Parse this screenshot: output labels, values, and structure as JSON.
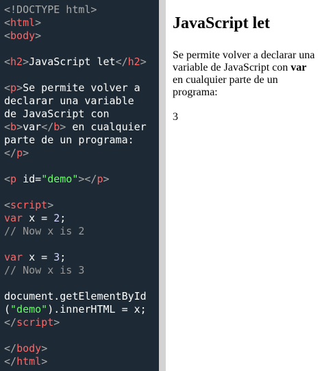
{
  "editor": {
    "code_lines": [
      [
        {
          "t": "<!DOCTYPE html>",
          "c": "bracket"
        }
      ],
      [
        {
          "t": "<",
          "c": "bracket"
        },
        {
          "t": "html",
          "c": "tag"
        },
        {
          "t": ">",
          "c": "bracket"
        }
      ],
      [
        {
          "t": "<",
          "c": "bracket"
        },
        {
          "t": "body",
          "c": "tag"
        },
        {
          "t": ">",
          "c": "bracket"
        }
      ],
      [],
      [
        {
          "t": "<",
          "c": "bracket"
        },
        {
          "t": "h2",
          "c": "tag"
        },
        {
          "t": ">",
          "c": "bracket"
        },
        {
          "t": "JavaScript let",
          "c": "text"
        },
        {
          "t": "</",
          "c": "bracket"
        },
        {
          "t": "h2",
          "c": "tag"
        },
        {
          "t": ">",
          "c": "bracket"
        }
      ],
      [],
      [
        {
          "t": "<",
          "c": "bracket"
        },
        {
          "t": "p",
          "c": "tag"
        },
        {
          "t": ">",
          "c": "bracket"
        },
        {
          "t": "Se permite volver a",
          "c": "text"
        }
      ],
      [
        {
          "t": "declarar una variable",
          "c": "text"
        }
      ],
      [
        {
          "t": "de JavaScript con",
          "c": "text"
        }
      ],
      [
        {
          "t": "<",
          "c": "bracket"
        },
        {
          "t": "b",
          "c": "tag"
        },
        {
          "t": ">",
          "c": "bracket"
        },
        {
          "t": "var",
          "c": "text"
        },
        {
          "t": "</",
          "c": "bracket"
        },
        {
          "t": "b",
          "c": "tag"
        },
        {
          "t": ">",
          "c": "bracket"
        },
        {
          "t": " en cualquier",
          "c": "text"
        }
      ],
      [
        {
          "t": "parte de un programa:",
          "c": "text"
        }
      ],
      [
        {
          "t": "</",
          "c": "bracket"
        },
        {
          "t": "p",
          "c": "tag"
        },
        {
          "t": ">",
          "c": "bracket"
        }
      ],
      [],
      [
        {
          "t": "<",
          "c": "bracket"
        },
        {
          "t": "p",
          "c": "tag"
        },
        {
          "t": " id",
          "c": "attr"
        },
        {
          "t": "=",
          "c": "eq"
        },
        {
          "t": "\"demo\"",
          "c": "string"
        },
        {
          "t": ">",
          "c": "bracket"
        },
        {
          "t": "</",
          "c": "bracket"
        },
        {
          "t": "p",
          "c": "tag"
        },
        {
          "t": ">",
          "c": "bracket"
        }
      ],
      [],
      [
        {
          "t": "<",
          "c": "bracket"
        },
        {
          "t": "script",
          "c": "tag"
        },
        {
          "t": ">",
          "c": "bracket"
        }
      ],
      [
        {
          "t": "var",
          "c": "keyword"
        },
        {
          "t": " x = ",
          "c": "plain"
        },
        {
          "t": "2",
          "c": "number"
        },
        {
          "t": ";",
          "c": "plain"
        }
      ],
      [
        {
          "t": "// Now x is 2",
          "c": "comment"
        }
      ],
      [],
      [
        {
          "t": "var",
          "c": "keyword"
        },
        {
          "t": " x = ",
          "c": "plain"
        },
        {
          "t": "3",
          "c": "number"
        },
        {
          "t": ";",
          "c": "plain"
        }
      ],
      [
        {
          "t": "// Now x is 3",
          "c": "comment"
        }
      ],
      [],
      [
        {
          "t": "document.getElementById",
          "c": "plain"
        }
      ],
      [
        {
          "t": "(",
          "c": "plain"
        },
        {
          "t": "\"demo\"",
          "c": "string"
        },
        {
          "t": ").innerHTML = x;",
          "c": "plain"
        }
      ],
      [
        {
          "t": "</",
          "c": "bracket"
        },
        {
          "t": "script",
          "c": "tag"
        },
        {
          "t": ">",
          "c": "bracket"
        }
      ],
      [],
      [
        {
          "t": "</",
          "c": "bracket"
        },
        {
          "t": "body",
          "c": "tag"
        },
        {
          "t": ">",
          "c": "bracket"
        }
      ],
      [
        {
          "t": "</",
          "c": "bracket"
        },
        {
          "t": "html",
          "c": "tag"
        },
        {
          "t": ">",
          "c": "bracket"
        }
      ]
    ]
  },
  "result": {
    "title": "JavaScript let",
    "paragraph_before_bold": "Se permite volver a declarar una variable de JavaScript con ",
    "paragraph_bold": "var",
    "paragraph_after_bold": " en cualquier parte de un programa:",
    "output": "3"
  },
  "colors": {
    "editor_bg": "#1d2a35",
    "divider": "#d3d3d3",
    "tag": "#ff6666",
    "bracket": "#aaaaaa",
    "string": "#66ff66",
    "comment": "#999999",
    "number": "#d3d3ff",
    "text": "#ffffff"
  }
}
